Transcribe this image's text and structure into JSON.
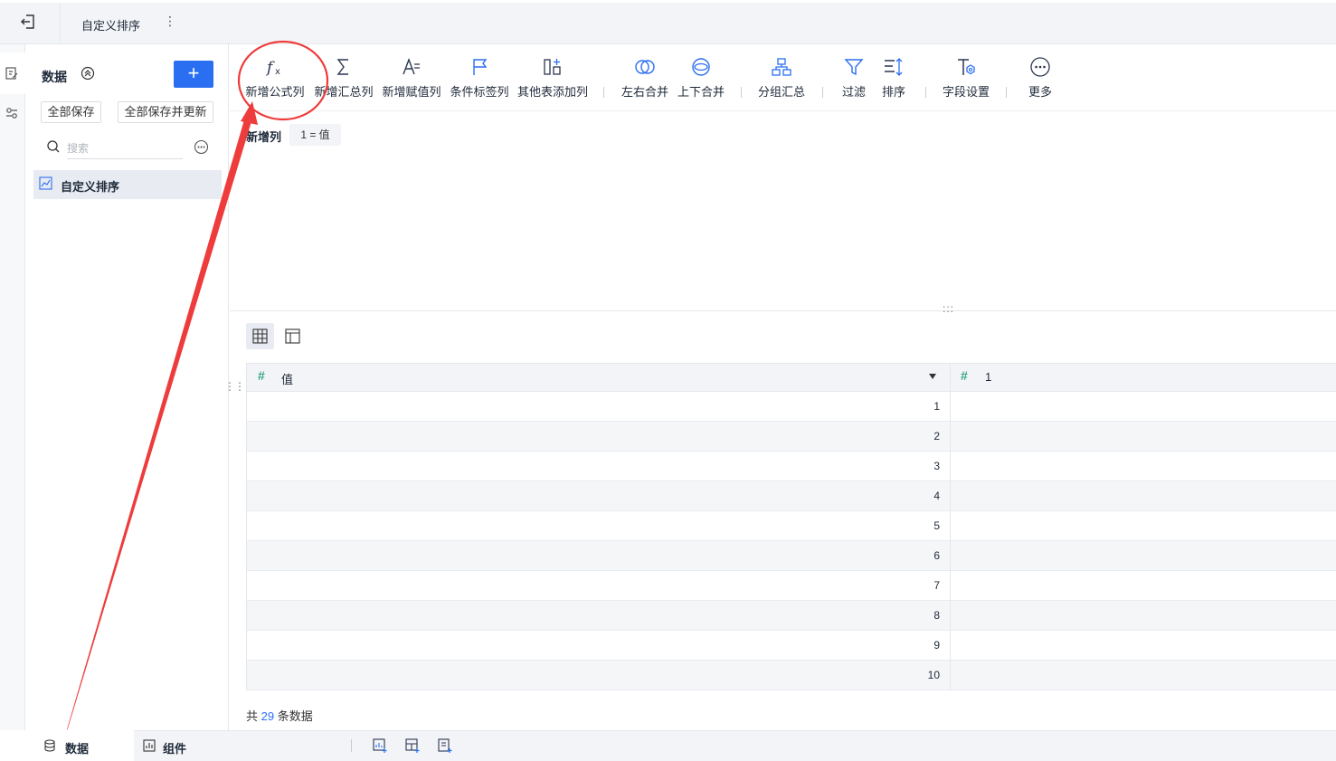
{
  "header": {
    "tab_title": "自定义排序",
    "more_glyph": "⋮"
  },
  "panel": {
    "title": "数据",
    "add_label": "+",
    "save_all": "全部保存",
    "save_all_update": "全部保存并更新",
    "search_placeholder": "搜索",
    "tree_item": "自定义排序"
  },
  "toolbar": [
    {
      "icon": "fx-icon",
      "label": "新增公式列"
    },
    {
      "icon": "sigma-icon",
      "label": "新增汇总列"
    },
    {
      "icon": "assign-icon",
      "label": "新增赋值列"
    },
    {
      "icon": "flag-icon",
      "label": "条件标签列"
    },
    {
      "icon": "add-table-icon",
      "label": "其他表添加列"
    },
    {
      "icon": "merge-lr-icon",
      "label": "左右合并"
    },
    {
      "icon": "merge-ud-icon",
      "label": "上下合并"
    },
    {
      "icon": "group-icon",
      "label": "分组汇总"
    },
    {
      "icon": "filter-icon",
      "label": "过滤"
    },
    {
      "icon": "sort-icon",
      "label": "排序"
    },
    {
      "icon": "field-settings-icon",
      "label": "字段设置"
    },
    {
      "icon": "more-icon",
      "label": "更多"
    }
  ],
  "step": {
    "label": "新增列",
    "chip": "1 = 值"
  },
  "table": {
    "columns": [
      {
        "type_glyph": "#",
        "label": "值"
      },
      {
        "type_glyph": "#",
        "label": "1"
      }
    ],
    "rows": [
      "1",
      "2",
      "3",
      "4",
      "5",
      "6",
      "7",
      "8",
      "9",
      "10"
    ],
    "total_prefix": "共",
    "total_count": "29",
    "total_suffix": "条数据"
  },
  "bottom": {
    "data_tab": "数据",
    "component_tab": "组件"
  },
  "colors": {
    "accent": "#2a6ff1",
    "annotation": "#ee3b3b",
    "number_type": "#3aa789"
  }
}
